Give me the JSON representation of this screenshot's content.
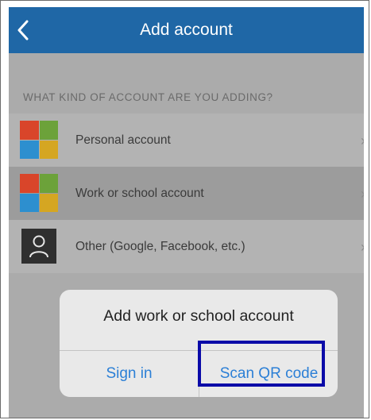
{
  "navbar": {
    "title": "Add account",
    "back_icon": "chevron-left-icon",
    "color": "#1f67a6"
  },
  "section": {
    "header": "WHAT KIND OF ACCOUNT ARE YOU ADDING?"
  },
  "accounts": [
    {
      "label": "Personal account",
      "icon": "microsoft-logo-icon"
    },
    {
      "label": "Work or school account",
      "icon": "microsoft-logo-icon",
      "selected": true
    },
    {
      "label": "Other (Google, Facebook, etc.)",
      "icon": "person-icon"
    }
  ],
  "dialog": {
    "title": "Add work or school account",
    "sign_in_label": "Sign in",
    "scan_qr_label": "Scan QR code",
    "button_color": "#2b7fd6"
  },
  "highlight": {
    "target": "Scan QR code",
    "color": "#0a0aa8"
  }
}
